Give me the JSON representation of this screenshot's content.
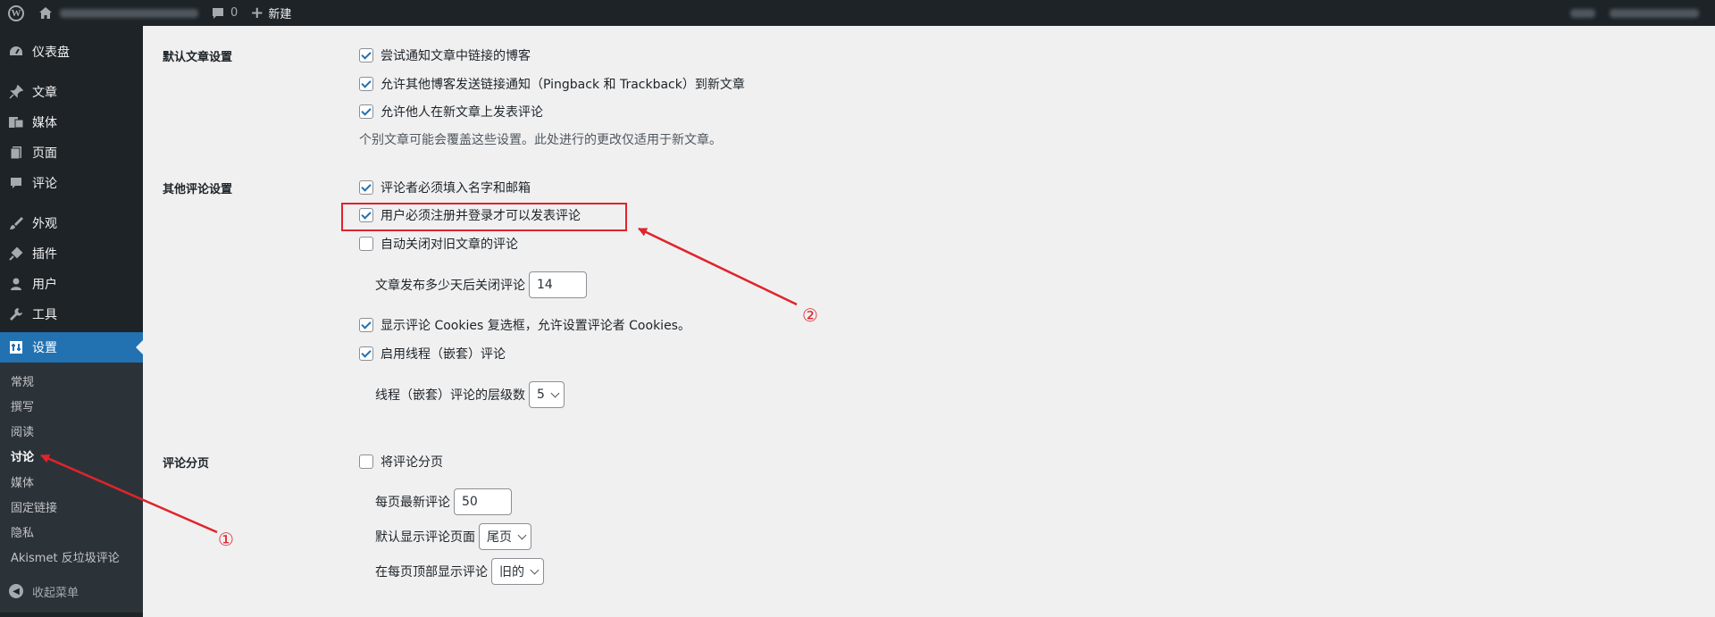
{
  "adminbar": {
    "comment_count": "0",
    "new_label": "新建"
  },
  "sidebar": {
    "items": [
      {
        "label": "仪表盘",
        "icon": "dashboard-icon"
      },
      {
        "label": "文章",
        "icon": "pin-icon"
      },
      {
        "label": "媒体",
        "icon": "media-icon"
      },
      {
        "label": "页面",
        "icon": "page-icon"
      },
      {
        "label": "评论",
        "icon": "comment-icon"
      },
      {
        "label": "外观",
        "icon": "brush-icon"
      },
      {
        "label": "插件",
        "icon": "plugin-icon"
      },
      {
        "label": "用户",
        "icon": "user-icon"
      },
      {
        "label": "工具",
        "icon": "wrench-icon"
      },
      {
        "label": "设置",
        "icon": "settings-icon"
      }
    ],
    "submenu": [
      "常规",
      "撰写",
      "阅读",
      "讨论",
      "媒体",
      "固定链接",
      "隐私",
      "Akismet 反垃圾评论"
    ],
    "collapse_label": "收起菜单"
  },
  "sections": {
    "default_article": {
      "heading": "默认文章设置",
      "options": [
        {
          "label": "尝试通知文章中链接的博客",
          "checked": true
        },
        {
          "label": "允许其他博客发送链接通知（Pingback 和 Trackback）到新文章",
          "checked": true
        },
        {
          "label": "允许他人在新文章上发表评论",
          "checked": true
        }
      ],
      "note": "个别文章可能会覆盖这些设置。此处进行的更改仅适用于新文章。"
    },
    "other_comments": {
      "heading": "其他评论设置",
      "options": [
        {
          "label": "评论者必须填入名字和邮箱",
          "checked": true
        },
        {
          "label": "用户必须注册并登录才可以发表评论",
          "checked": true
        },
        {
          "label": "自动关闭对旧文章的评论",
          "checked": false
        }
      ],
      "close_days_label": "文章发布多少天后关闭评论",
      "close_days_value": "14",
      "cookies_label": "显示评论 Cookies 复选框，允许设置评论者 Cookies。",
      "cookies_checked": true,
      "threaded_label": "启用线程（嵌套）评论",
      "threaded_checked": true,
      "thread_depth_label": "线程（嵌套）评论的层级数",
      "thread_depth_value": "5"
    },
    "pagination": {
      "heading": "评论分页",
      "paginate_label": "将评论分页",
      "paginate_checked": false,
      "per_page_label": "每页最新评论",
      "per_page_value": "50",
      "default_page_label": "默认显示评论页面",
      "default_page_value": "尾页",
      "top_order_label": "在每页顶部显示评论",
      "top_order_value": "旧的"
    }
  },
  "annotations": {
    "marker_1": "①",
    "marker_2": "②",
    "color": "#e0242b"
  }
}
